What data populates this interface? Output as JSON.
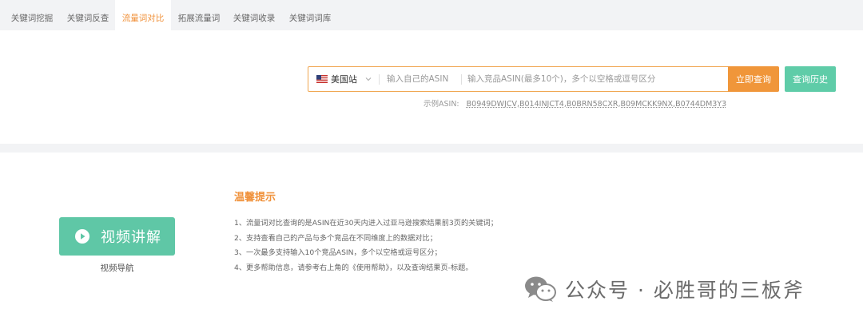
{
  "tabs": [
    {
      "label": "关键词挖掘",
      "active": false
    },
    {
      "label": "关键词反查",
      "active": false
    },
    {
      "label": "流量词对比",
      "active": true
    },
    {
      "label": "拓展流量词",
      "active": false
    },
    {
      "label": "关键词收录",
      "active": false
    },
    {
      "label": "关键词词库",
      "active": false
    }
  ],
  "search": {
    "site": "美国站",
    "own_asin_placeholder": "输入自己的ASIN",
    "competitor_placeholder": "输入竞品ASIN(最多10个)，多个以空格或逗号区分",
    "query_button": "立即查询",
    "history_button": "查询历史",
    "example_label": "示例ASIN:",
    "example_asins": "B0949DWJCV,B014INJCT4,B0BRN58CXR,B09MCKK9NX,B0744DM3Y3"
  },
  "video": {
    "button_label": "视频讲解",
    "caption": "视频导航"
  },
  "tips": {
    "title": "温馨提示",
    "items": [
      "1、流量词对比查询的是ASIN在近30天内进入过亚马逊搜索结果前3页的关键词；",
      "2、支持查看自己的产品与多个竞品在不同维度上的数据对比；",
      "3、一次最多支持输入10个竞品ASIN，多个以空格或逗号区分；",
      "4、更多帮助信息，请参考右上角的《使用帮助》，以及查询结果页-标题。"
    ]
  },
  "watermark": {
    "text": "公众号 · 必胜哥的三板斧"
  },
  "colors": {
    "accent_orange": "#f0913a",
    "accent_green": "#5fc7a6",
    "tab_bar_bg": "#f2f3f5"
  },
  "icons": {
    "site_flag": "us-flag-icon",
    "site_dropdown": "chevron-down-icon",
    "video": "play-icon",
    "watermark": "wechat-icon"
  }
}
